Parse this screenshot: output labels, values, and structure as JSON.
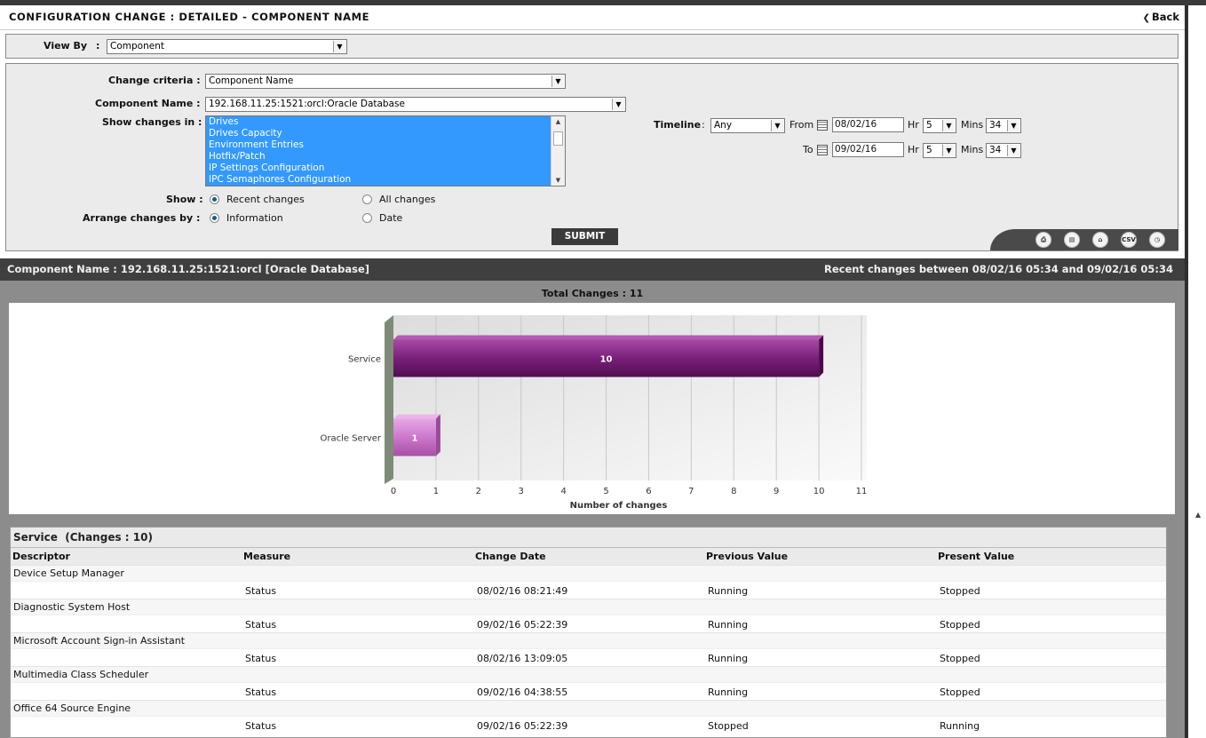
{
  "header": {
    "title": "CONFIGURATION CHANGE : DETAILED - COMPONENT NAME",
    "back_label": "Back"
  },
  "view_by": {
    "label": "View By",
    "separator": ":",
    "value": "Component"
  },
  "criteria": {
    "change_criteria_label": "Change criteria :",
    "change_criteria_value": "Component Name",
    "component_name_label": "Component Name :",
    "component_name_value": "192.168.11.25:1521:orcl:Oracle Database",
    "show_changes_in_label": "Show changes in :",
    "show_changes_in_options": [
      "Drives",
      "Drives Capacity",
      "Environment Entries",
      "Hotfix/Patch",
      "IP Settings Configuration",
      "IPC Semaphores Configuration"
    ],
    "show_label": "Show :",
    "show_options": [
      {
        "label": "Recent changes",
        "selected": true
      },
      {
        "label": "All changes",
        "selected": false
      }
    ],
    "arrange_label": "Arrange changes by :",
    "arrange_options": [
      {
        "label": "Information",
        "selected": true
      },
      {
        "label": "Date",
        "selected": false
      }
    ],
    "timeline_label": "Timeline",
    "timeline_sep": ":",
    "timeline_value": "Any",
    "from_label": "From",
    "from_date": "08/02/16",
    "to_label": "To",
    "to_date": "09/02/16",
    "hr_label": "Hr",
    "from_hr": "5",
    "to_hr": "5",
    "mins_label": "Mins",
    "from_mins": "34",
    "to_mins": "34",
    "submit_label": "SUBMIT"
  },
  "toolbar": {
    "icons": [
      {
        "name": "print-icon",
        "glyph": "⎙"
      },
      {
        "name": "pdf-icon",
        "glyph": "▤"
      },
      {
        "name": "home-icon",
        "glyph": "⌂"
      },
      {
        "name": "csv-icon",
        "glyph": "CSV"
      },
      {
        "name": "timer-icon",
        "glyph": "◷"
      }
    ]
  },
  "summary": {
    "component": "Component Name : 192.168.11.25:1521:orcl [Oracle Database]",
    "range": "Recent changes between 08/02/16 05:34 and 09/02/16 05:34",
    "total": "Total Changes : 11"
  },
  "chart_data": {
    "type": "bar",
    "orientation": "horizontal",
    "categories": [
      "Service",
      "Oracle Server"
    ],
    "values": [
      10,
      1
    ],
    "value_labels": [
      "10",
      "1"
    ],
    "colors": [
      "#7a1f7a",
      "#cc77cc"
    ],
    "xlabel": "Number of changes",
    "xlim": [
      0,
      11
    ],
    "xticks": [
      "0",
      "1",
      "2",
      "3",
      "4",
      "5",
      "6",
      "7",
      "8",
      "9",
      "10",
      "11"
    ],
    "grid": true
  },
  "table": {
    "title": "Service",
    "title_count": "(Changes : 10)",
    "columns": [
      "Descriptor",
      "Measure",
      "Change Date",
      "Previous Value",
      "Present Value"
    ],
    "rows": [
      {
        "descriptor": "Device Setup Manager",
        "measure": "Status",
        "date": "08/02/16 08:21:49",
        "previous": "Running",
        "present": "Stopped"
      },
      {
        "descriptor": "Diagnostic System Host",
        "measure": "Status",
        "date": "09/02/16 05:22:39",
        "previous": "Running",
        "present": "Stopped"
      },
      {
        "descriptor": "Microsoft Account Sign-in Assistant",
        "measure": "Status",
        "date": "08/02/16 13:09:05",
        "previous": "Running",
        "present": "Stopped"
      },
      {
        "descriptor": "Multimedia Class Scheduler",
        "measure": "Status",
        "date": "09/02/16 04:38:55",
        "previous": "Running",
        "present": "Stopped"
      },
      {
        "descriptor": "Office 64 Source Engine",
        "measure": "Status",
        "date": "09/02/16 05:22:39",
        "previous": "Stopped",
        "present": "Running"
      }
    ]
  }
}
